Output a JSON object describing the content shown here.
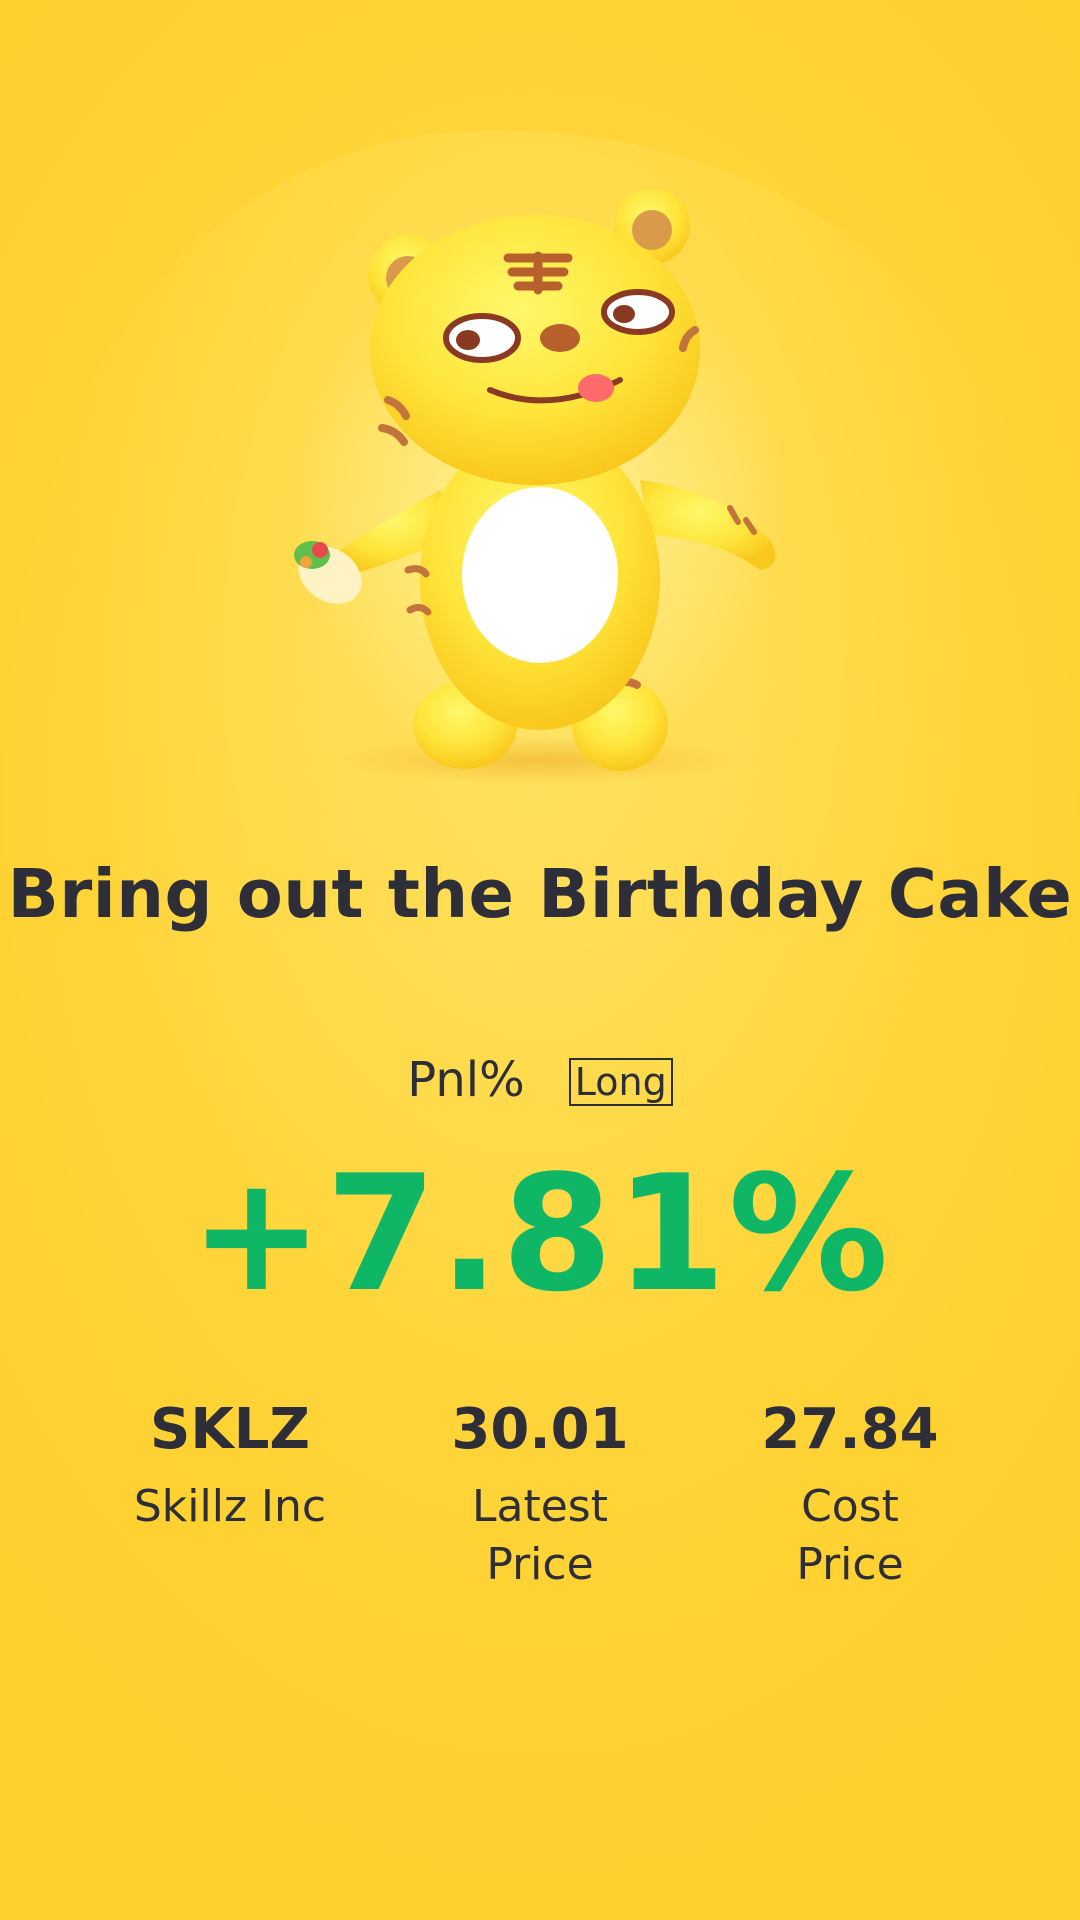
{
  "headline": "Bring out the Birthday Cake",
  "pnl": {
    "label": "Pnl%",
    "badge": "Long",
    "value": "+7.81%",
    "value_color": "#0fb666"
  },
  "stats": [
    {
      "top": "SKLZ",
      "sub": "Skillz Inc"
    },
    {
      "top": "30.01",
      "sub": "Latest Price"
    },
    {
      "top": "27.84",
      "sub": "Cost Price"
    }
  ],
  "colors": {
    "background": "#ffd63e",
    "text": "#2e2e38",
    "accent_green": "#0fb666"
  },
  "mascot": {
    "icon": "tiger-mascot-icon"
  }
}
